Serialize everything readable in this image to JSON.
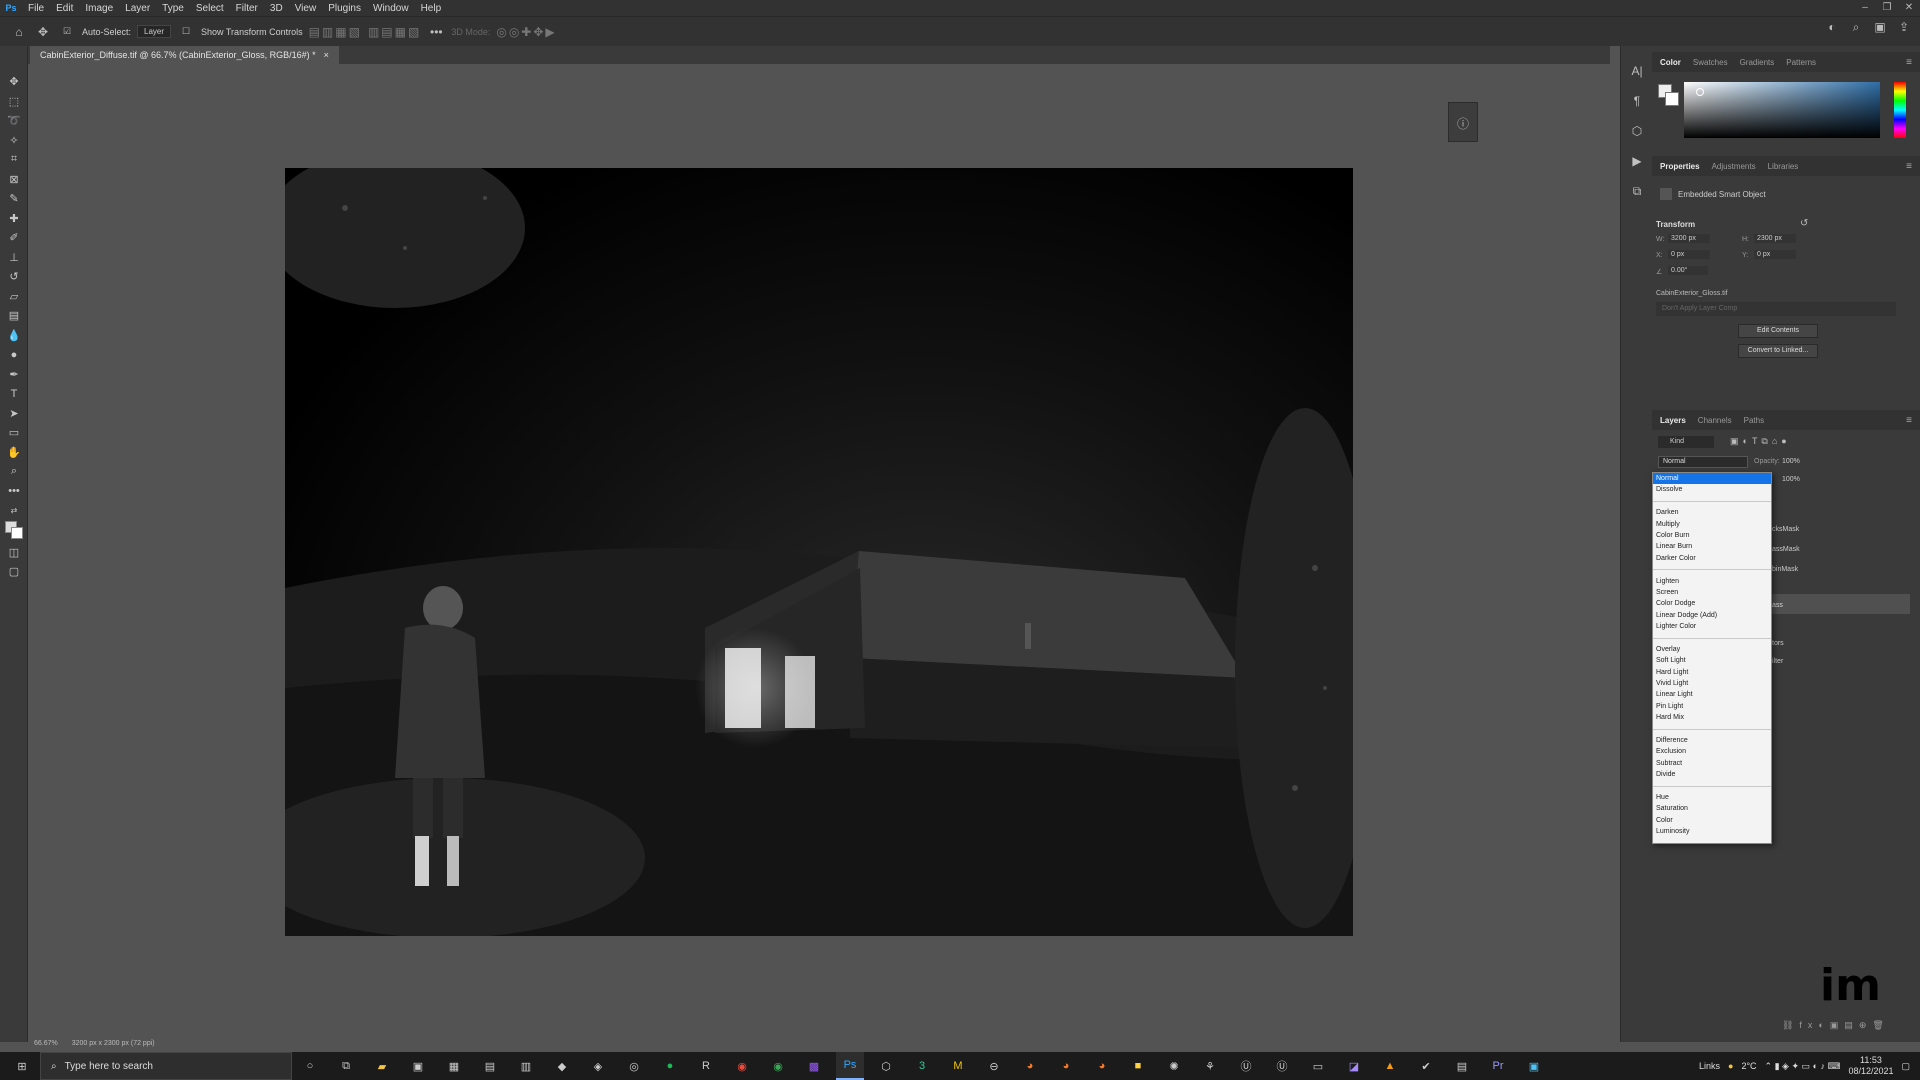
{
  "app": {
    "logo": "Ps"
  },
  "menu": [
    "File",
    "Edit",
    "Image",
    "Layer",
    "Type",
    "Select",
    "Filter",
    "3D",
    "View",
    "Plugins",
    "Window",
    "Help"
  ],
  "options": {
    "auto_select_label": "Auto-Select:",
    "auto_select_value": "Layer",
    "show_transform": "Show Transform Controls",
    "mode_3d": "3D Mode:"
  },
  "document": {
    "tab_title": "CabinExterior_Diffuse.tif @ 66.7% (CabinExterior_Gloss, RGB/16#) *",
    "zoom": "66.67%",
    "doc_size": "3200 px x 2300 px (72 ppi)"
  },
  "color_panel": {
    "tabs": [
      "Color",
      "Swatches",
      "Gradients",
      "Patterns"
    ]
  },
  "properties_panel": {
    "tabs": [
      "Properties",
      "Adjustments",
      "Libraries"
    ],
    "smart_object": "Embedded Smart Object",
    "transform_label": "Transform",
    "w_label": "W:",
    "w_value": "3200 px",
    "h_label": "H:",
    "h_value": "2300 px",
    "x_label": "X:",
    "x_value": "0 px",
    "y_label": "Y:",
    "y_value": "0 px",
    "angle_value": "0.00°",
    "filename": "CabinExterior_Gloss.tif",
    "layer_comp": "Don't Apply Layer Comp",
    "edit_contents": "Edit Contents",
    "convert_linked": "Convert to Linked..."
  },
  "layers_panel": {
    "tabs": [
      "Layers",
      "Channels",
      "Paths"
    ],
    "kind": "Kind",
    "blend_mode": "Normal",
    "opacity_label": "Opacity:",
    "opacity_value": "100%",
    "fill_value": "100%",
    "partial_labels": [
      "cksMask",
      "assMask",
      "binMask",
      "ass",
      "tors",
      "ilter"
    ]
  },
  "blend_dropdown": {
    "groups": [
      [
        "Normal",
        "Dissolve"
      ],
      [
        "Darken",
        "Multiply",
        "Color Burn",
        "Linear Burn",
        "Darker Color"
      ],
      [
        "Lighten",
        "Screen",
        "Color Dodge",
        "Linear Dodge (Add)",
        "Lighter Color"
      ],
      [
        "Overlay",
        "Soft Light",
        "Hard Light",
        "Vivid Light",
        "Linear Light",
        "Pin Light",
        "Hard Mix"
      ],
      [
        "Difference",
        "Exclusion",
        "Subtract",
        "Divide"
      ],
      [
        "Hue",
        "Saturation",
        "Color",
        "Luminosity"
      ]
    ],
    "selected": "Normal"
  },
  "taskbar": {
    "search_placeholder": "Type here to search",
    "links_label": "Links",
    "temperature": "2°C",
    "time": "11:53",
    "date": "08/12/2021"
  },
  "colors": {
    "selected_blue": "#1473e6",
    "ps_blue": "#31a8ff"
  }
}
